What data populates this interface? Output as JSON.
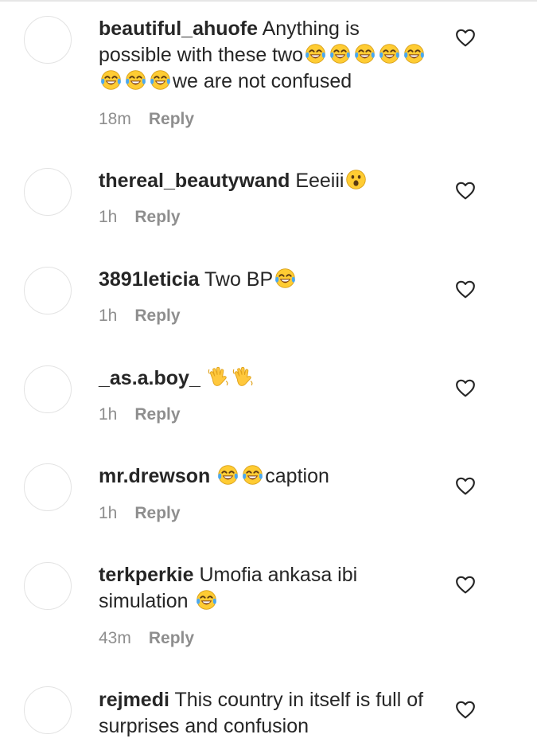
{
  "comments": [
    {
      "username": "beautiful_ahuofe",
      "text_before": "Anything is possible with these two",
      "emojis_mid": [
        "laughing-tears",
        "laughing-tears",
        "laughing-tears",
        "laughing-tears",
        "laughing-tears",
        "laughing-tears",
        "laughing-tears",
        "laughing-tears"
      ],
      "text_after": "we are not confused",
      "time": "18m",
      "reply": "Reply"
    },
    {
      "username": "thereal_beautywand",
      "text_before": "Eeeiii",
      "emojis_mid": [
        "surprised-face"
      ],
      "text_after": "",
      "time": "1h",
      "reply": "Reply"
    },
    {
      "username": "3891leticia",
      "text_before": "Two BP",
      "emojis_mid": [
        "laughing-tears"
      ],
      "text_after": "",
      "time": "1h",
      "reply": "Reply"
    },
    {
      "username": "_as.a.boy_",
      "text_before": "",
      "emojis_mid": [
        "waving-hand",
        "waving-hand"
      ],
      "text_after": "",
      "time": "1h",
      "reply": "Reply"
    },
    {
      "username": "mr.drewson",
      "text_before": "",
      "emojis_mid": [
        "laughing-tears",
        "laughing-tears"
      ],
      "text_after": "caption",
      "time": "1h",
      "reply": "Reply"
    },
    {
      "username": "terkperkie",
      "text_before": "Umofia ankasa ibi simulation",
      "emojis_mid": [
        "laughing-tears"
      ],
      "text_after": "",
      "time": "43m",
      "reply": "Reply"
    },
    {
      "username": "rejmedi",
      "text_before": "This country in itself is full of surprises and confusion",
      "emojis_mid": [],
      "text_after": "",
      "time": "",
      "reply": ""
    }
  ]
}
